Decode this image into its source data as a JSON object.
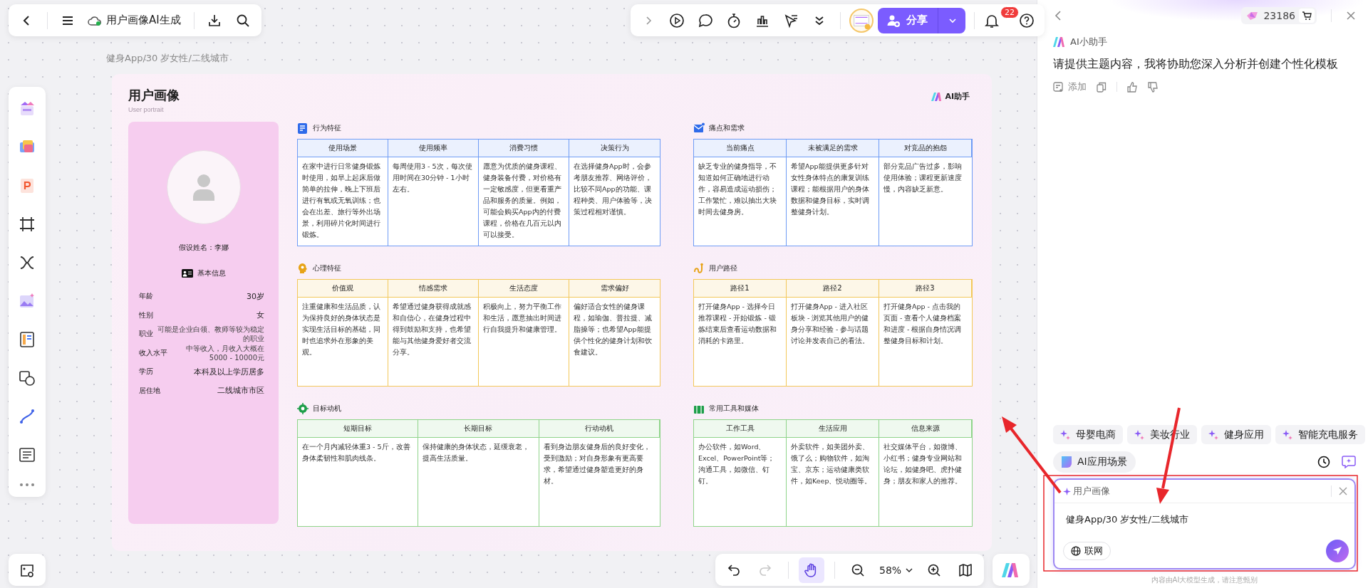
{
  "top_bar": {
    "title": "用户画像AI生成"
  },
  "breadcrumb": "健身App/30 岁女性/二线城市",
  "toolbar": {
    "share_label": "分享",
    "notifications": "22"
  },
  "card": {
    "title": "用户画像",
    "subtitle": "User portrait",
    "logo_label": "AI助手",
    "persona": {
      "name": "假设姓名：李娜",
      "info_title": "基本信息",
      "fields": [
        {
          "label": "年龄",
          "value": "30岁",
          "small": false
        },
        {
          "label": "性别",
          "value": "女",
          "small": false
        },
        {
          "label": "职业",
          "value": "可能是企业白领、教师等较为稳定的职业",
          "small": true
        },
        {
          "label": "收入水平",
          "value": "中等收入，月收入大概在5000 - 10000元",
          "small": true
        },
        {
          "label": "学历",
          "value": "本科及以上学历居多",
          "small": false
        },
        {
          "label": "居住地",
          "value": "二线城市市区",
          "small": false
        }
      ]
    },
    "sections": [
      {
        "kind": "document",
        "title": "行为特征",
        "color": "#6f9cf5",
        "columns": [
          "使用场景",
          "使用频率",
          "消费习惯",
          "决策行为"
        ],
        "cells": [
          "在家中进行日常健身锻炼时使用，如早上起床后做简单的拉伸，晚上下班后进行有氧或无氧训练；也会在出差、旅行等外出场景，利用碎片化时间进行锻炼。",
          "每周使用3 - 5次，每次使用时间在30分钟 - 1小时左右。",
          "愿意为优质的健身课程、健身装备付费，对价格有一定敏感度，但更看重产品和服务的质量。例如，可能会购买App内的付费课程，价格在几百元以内可以接受。",
          "在选择健身App时，会参考朋友推荐、网络评价，比较不同App的功能、课程种类、用户体验等，决策过程相对谨慎。"
        ]
      },
      {
        "kind": "mail",
        "title": "痛点和需求",
        "color": "#6f9cf5",
        "columns": [
          "当前痛点",
          "未被满足的需求",
          "对竞品的抱怨"
        ],
        "cells": [
          "缺乏专业的健身指导，不知道如何正确地进行动作，容易造成运动损伤；工作繁忙，难以抽出大块时间去健身房。",
          "希望App能提供更多针对女性身体特点的康复训练课程；能根据用户的身体数据和健身目标，实时调整健身计划。",
          "部分竞品广告过多，影响使用体验；课程更新速度慢，内容缺乏新意。"
        ]
      },
      {
        "kind": "head",
        "title": "心理特征",
        "color": "#f3c85a",
        "columns": [
          "价值观",
          "情感需求",
          "生活态度",
          "需求偏好"
        ],
        "cells": [
          "注重健康和生活品质，认为保持良好的身体状态是实现生活目标的基础，同时也追求外在形象的美观。",
          "希望通过健身获得成就感和自信心，在健身过程中得到鼓励和支持，也希望能与其他健身爱好者交流分享。",
          "积极向上，努力平衡工作和生活，愿意抽出时间进行自我提升和健康管理。",
          "偏好适合女性的健身课程，如瑜伽、普拉提、减脂操等；也希望App能提供个性化的健身计划和饮食建议。"
        ]
      },
      {
        "kind": "path",
        "title": "用户路径",
        "color": "#f3c85a",
        "columns": [
          "路径1",
          "路径2",
          "路径3"
        ],
        "cells": [
          "打开健身App - 选择今日推荐课程 - 开始锻炼 - 锻炼结束后查看运动数据和消耗的卡路里。",
          "打开健身App - 进入社区板块 - 浏览其他用户的健身分享和经验 - 参与话题讨论并发表自己的看法。",
          "打开健身App - 点击我的页面 - 查看个人健身档案和进度 - 根据自身情况调整健身目标和计划。"
        ]
      },
      {
        "kind": "target",
        "title": "目标动机",
        "color": "#8fd48a",
        "columns": [
          "短期目标",
          "长期目标",
          "行动动机"
        ],
        "cells": [
          "在一个月内减轻体重3 - 5斤，改善身体柔韧性和肌肉线条。",
          "保持健康的身体状态，延缓衰老，提高生活质量。",
          "看到身边朋友健身后的良好变化，受到激励；对自身形象有更高要求，希望通过健身塑造更好的身材。"
        ]
      },
      {
        "kind": "briefcase",
        "title": "常用工具和媒体",
        "color": "#8fd48a",
        "columns": [
          "工作工具",
          "生活应用",
          "信息来源"
        ],
        "cells": [
          "办公软件，如Word、Excel、PowerPoint等；沟通工具，如微信、钉钉。",
          "外卖软件，如美团外卖、饿了么；购物软件，如淘宝、京东；运动健康类软件，如Keep、悦动圈等。",
          "社交媒体平台，如微博、小红书；健身专业网站和论坛，如健身吧、虎扑健身；朋友和家人的推荐。"
        ]
      }
    ]
  },
  "bottom_bar": {
    "redo_disabled": true,
    "hand_selected": true,
    "zoom": "58%"
  },
  "assistant": {
    "credits": "23186",
    "name": "AI小助手",
    "message": "请提供主题内容，我将协助您深入分析并创建个性化模板",
    "add_label": "添加",
    "chips": [
      "母婴电商",
      "美妆行业",
      "健身应用",
      "智能充电服务"
    ],
    "scene_label": "AI应用场景",
    "input": {
      "tag": "用户画像",
      "value": "健身App/30 岁女性/二线城市",
      "web_label": "联网"
    },
    "footer": "内容由AI大模型生成，请注意甄别"
  }
}
